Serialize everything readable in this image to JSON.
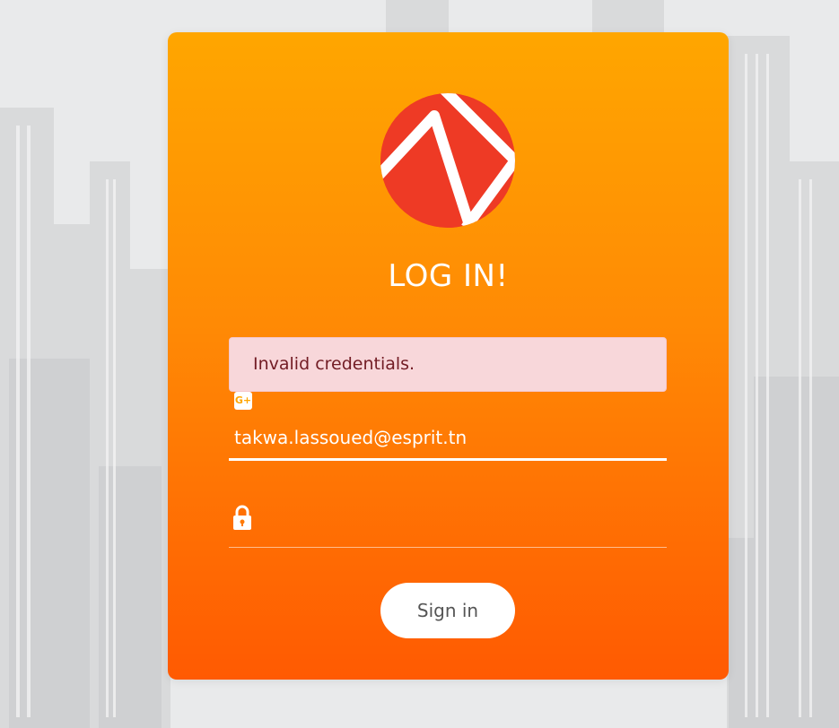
{
  "login": {
    "title": "LOG IN!",
    "alert": "Invalid credentials.",
    "email_value": "takwa.lassoued@esprit.tn",
    "password_value": "",
    "signin_label": "Sign in",
    "gplus_icon_text": "G+"
  },
  "icons": {
    "email": "google-plus-icon",
    "password": "lock-icon"
  },
  "colors": {
    "card_top": "#ffa600",
    "card_bottom": "#ff5a02",
    "alert_bg": "#f8d7da",
    "alert_text": "#721c24",
    "logo_red": "#ee3a25"
  }
}
